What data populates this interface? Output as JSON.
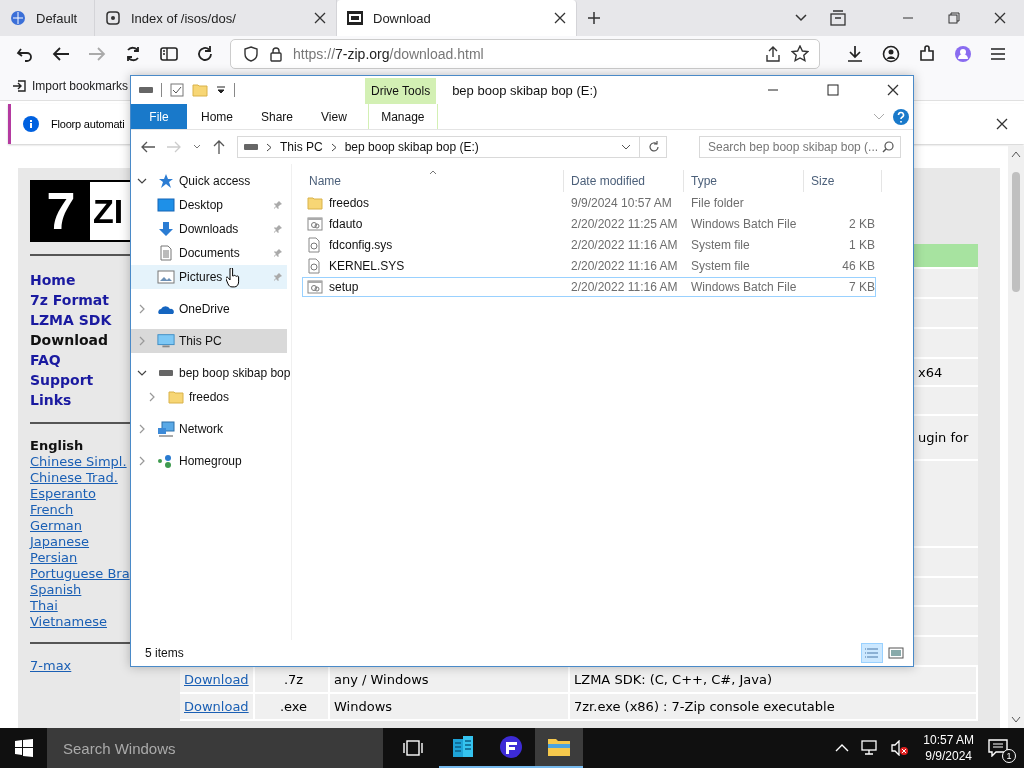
{
  "browser": {
    "tabs": [
      {
        "title": "Default",
        "kind": "globe",
        "selected": false,
        "closable": false
      },
      {
        "title": "Index of /isos/dos/",
        "kind": "server",
        "selected": false,
        "closable": true
      },
      {
        "title": "Download",
        "kind": "archive",
        "selected": true,
        "closable": true
      }
    ],
    "url": {
      "scheme": "https://",
      "host": "7-zip.org",
      "path": "/download.html"
    },
    "bookmark": "Import bookmarks",
    "notification": "Floorp automati"
  },
  "webpage": {
    "logo": {
      "digit": "7",
      "letters": "ZI"
    },
    "nav": [
      {
        "label": "Home",
        "current": false
      },
      {
        "label": "7z Format",
        "current": false
      },
      {
        "label": "LZMA SDK",
        "current": false
      },
      {
        "label": "Download",
        "current": true
      },
      {
        "label": "FAQ",
        "current": false
      },
      {
        "label": "Support",
        "current": false
      },
      {
        "label": "Links",
        "current": false
      }
    ],
    "languages": [
      {
        "label": "English",
        "current": true
      },
      {
        "label": "Chinese Simpl.",
        "current": false
      },
      {
        "label": "Chinese Trad.",
        "current": false
      },
      {
        "label": "Esperanto",
        "current": false
      },
      {
        "label": "French",
        "current": false
      },
      {
        "label": "German",
        "current": false
      },
      {
        "label": "Japanese",
        "current": false
      },
      {
        "label": "Persian",
        "current": false
      },
      {
        "label": "Portuguese Bra",
        "current": false
      },
      {
        "label": "Spanish",
        "current": false
      },
      {
        "label": "Thai",
        "current": false
      },
      {
        "label": "Vietnamese",
        "current": false
      }
    ],
    "extra_link": "7-max",
    "table_rows": [
      {
        "kind": "header"
      },
      {
        "kind": "blank"
      },
      {
        "kind": "blank"
      },
      {
        "kind": "blank"
      },
      {
        "kind": "fragment",
        "text": "x64"
      },
      {
        "kind": "blank"
      },
      {
        "kind": "fragment",
        "text": "ugin for"
      },
      {
        "kind": "blank"
      },
      {
        "kind": "blank"
      },
      {
        "kind": "blank"
      },
      {
        "kind": "blank"
      },
      {
        "kind": "blank"
      },
      {
        "kind": "full",
        "cells": [
          "Download",
          ".7z",
          "any / Windows",
          "LZMA SDK: (C, C++, C#, Java)"
        ]
      },
      {
        "kind": "full",
        "cells": [
          "Download",
          ".exe",
          "Windows",
          "7zr.exe (x86) : 7-Zip console executable"
        ]
      }
    ]
  },
  "explorer": {
    "title": "bep boop skibap bop (E:)",
    "context_group": "Drive Tools",
    "ribbon_tabs": [
      {
        "label": "File",
        "kind": "file"
      },
      {
        "label": "Home",
        "kind": "plain"
      },
      {
        "label": "Share",
        "kind": "plain"
      },
      {
        "label": "View",
        "kind": "plain"
      },
      {
        "label": "Manage",
        "kind": "context"
      }
    ],
    "breadcrumb": [
      "This PC",
      "bep boop skibap bop (E:)"
    ],
    "search_placeholder": "Search bep boop skibap bop (...",
    "nav": [
      {
        "label": "Quick access",
        "kind": "star",
        "expanded": true,
        "selected": false,
        "hovered": false,
        "children": [
          {
            "label": "Desktop",
            "kind": "desktop",
            "pinned": true,
            "selected": false,
            "hovered": false
          },
          {
            "label": "Downloads",
            "kind": "download",
            "pinned": true,
            "selected": false,
            "hovered": false
          },
          {
            "label": "Documents",
            "kind": "document",
            "pinned": true,
            "selected": false,
            "hovered": false
          },
          {
            "label": "Pictures",
            "kind": "pictures",
            "pinned": true,
            "selected": false,
            "hovered": true
          }
        ]
      },
      {
        "label": "OneDrive",
        "kind": "cloud",
        "expanded": false,
        "selected": false,
        "hovered": false
      },
      {
        "label": "This PC",
        "kind": "computer",
        "expanded": false,
        "selected": true,
        "hovered": false
      },
      {
        "label": "bep boop skibap bop",
        "kind": "drive",
        "expanded": true,
        "selected": false,
        "hovered": false,
        "children": [
          {
            "label": "freedos",
            "kind": "folder",
            "pinned": false,
            "selected": false,
            "hovered": false
          }
        ]
      },
      {
        "label": "Network",
        "kind": "network",
        "expanded": false,
        "selected": false,
        "hovered": false
      },
      {
        "label": "Homegroup",
        "kind": "homegroup",
        "expanded": false,
        "selected": false,
        "hovered": false
      }
    ],
    "columns": [
      "Name",
      "Date modified",
      "Type",
      "Size"
    ],
    "files": [
      {
        "name": "freedos",
        "kind": "folder",
        "date": "9/9/2024 10:57 AM",
        "type": "File folder",
        "selected": false
      },
      {
        "name": "fdauto",
        "kind": "batch",
        "date": "2/20/2022 11:25 AM",
        "type": "Windows Batch File",
        "size": "2 KB",
        "selected": false
      },
      {
        "name": "fdconfig.sys",
        "kind": "system",
        "date": "2/20/2022 11:16 AM",
        "type": "System file",
        "size": "1 KB",
        "selected": false
      },
      {
        "name": "KERNEL.SYS",
        "kind": "system",
        "date": "2/20/2022 11:16 AM",
        "type": "System file",
        "size": "46 KB",
        "selected": false
      },
      {
        "name": "setup",
        "kind": "batch",
        "date": "2/20/2022 11:16 AM",
        "type": "Windows Batch File",
        "size": "7 KB",
        "selected": true
      }
    ],
    "status": "5 items",
    "details_view": true
  },
  "taskbar": {
    "search_placeholder": "Search Windows",
    "apps": [
      {
        "kind": "building",
        "running": true,
        "selected": false
      },
      {
        "kind": "browser",
        "running": true,
        "selected": false
      },
      {
        "kind": "folder",
        "running": true,
        "selected": true
      }
    ],
    "time": "10:57 AM",
    "date": "9/9/2024",
    "notifications": "1"
  }
}
